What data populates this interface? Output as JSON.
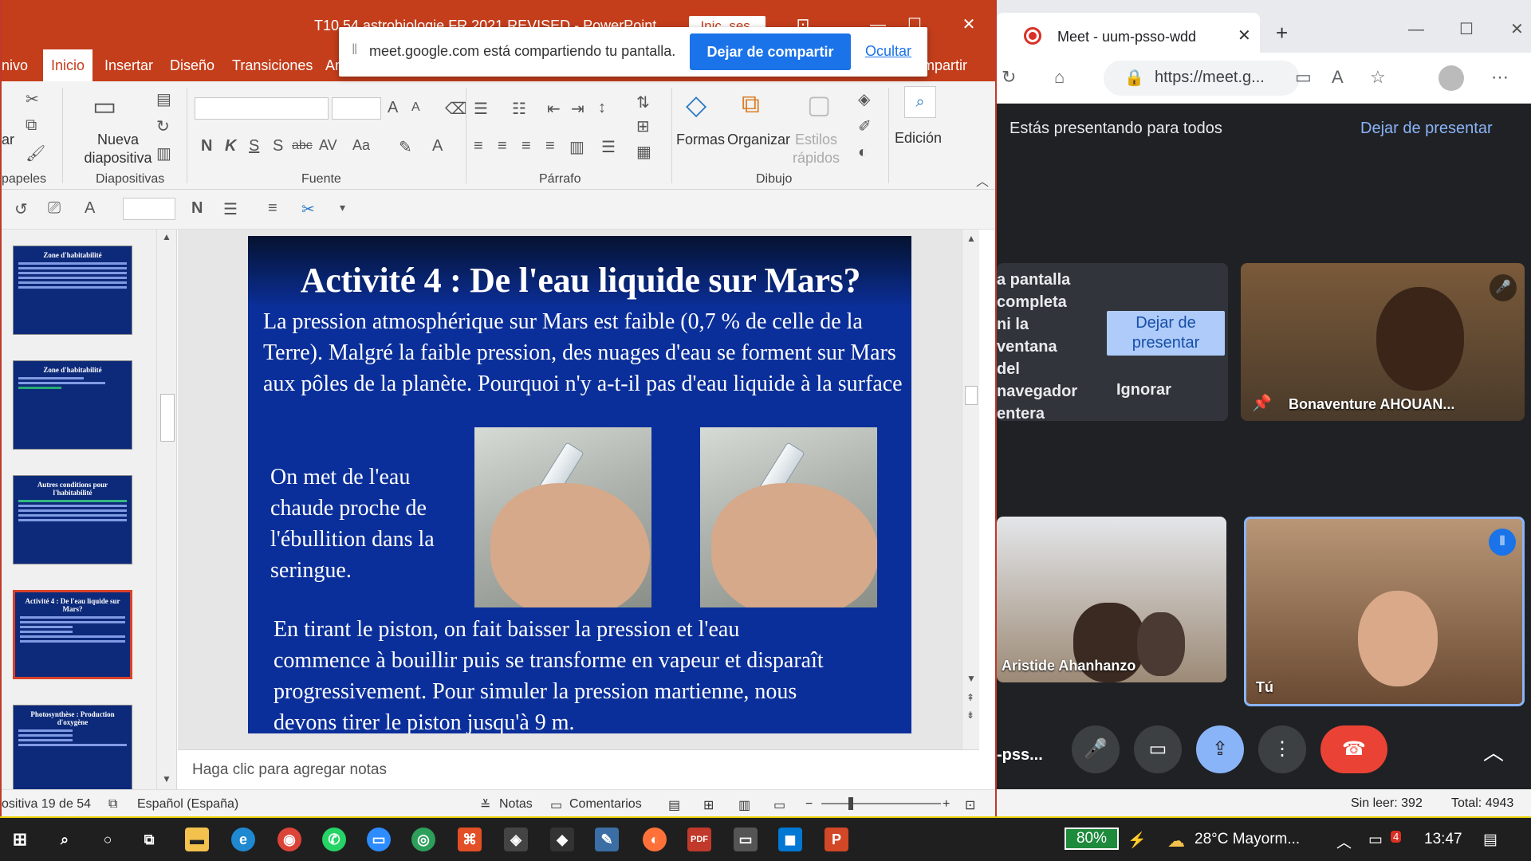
{
  "ppt": {
    "title": "T10 54 astrobiologie FR 2021 REVISED  -  PowerPoint",
    "signin": "Inic. ses.",
    "tabs": [
      "nivo",
      "Inicio",
      "Insertar",
      "Diseño",
      "Transiciones",
      "An",
      "mpartir"
    ],
    "ribbon": {
      "clipboard_cut_label": "ar",
      "clipboard_group": "papeles",
      "new_slide": "Nueva\ndiapositiva",
      "slides_group": "Diapositivas",
      "font_group": "Fuente",
      "para_group": "Párrafo",
      "shapes": "Formas",
      "arrange": "Organizar",
      "quick_styles": "Estilos\nrápidos",
      "draw_group": "Dibujo",
      "editing": "Edición",
      "font_btns": [
        "N",
        "K",
        "S",
        "S",
        "abc",
        "AV",
        "Aa"
      ]
    },
    "thumbnails": [
      {
        "title": "Zone d'habitabilité"
      },
      {
        "title": "Zone d'habitabilité"
      },
      {
        "title": "Autres conditions pour l'habitabilité"
      },
      {
        "title": "Activité 4 : De l'eau liquide sur Mars?"
      },
      {
        "title": "Photosynthèse : Production d'oxygène"
      }
    ],
    "slide": {
      "title": "Activité 4 : De l'eau liquide sur Mars?",
      "intro": "La pression atmosphérique sur Mars est faible (0,7 % de celle de la Terre). Malgré la faible pression, des nuages d'eau se forment sur Mars aux pôles de la planète. Pourquoi n'y a-t-il pas d'eau liquide à la surface",
      "left": "On met de l'eau chaude proche de l'ébullition dans la seringue.",
      "bottom": "En tirant le piston, on fait baisser la pression et l'eau commence à bouillir puis se transforme en vapeur et disparaît progressivement. Pour simuler la pression martienne, nous devons tirer le piston jusqu'à 9 m."
    },
    "notes_placeholder": "Haga clic para agregar notas",
    "status": {
      "slide": "ositiva 19 de 54",
      "lang": "Español (España)",
      "notes": "Notas",
      "comments": "Comentarios"
    }
  },
  "share_bar": {
    "text": "meet.google.com está compartiendo tu pantalla.",
    "stop": "Dejar de compartir",
    "hide": "Ocultar"
  },
  "browser": {
    "tab_title": "Meet - uum-psso-wdd",
    "url": "https://meet.g...",
    "banner": "Estás presentando para todos",
    "banner_stop": "Dejar de presentar",
    "present_tile": {
      "lines": [
        "a pantalla",
        "completa",
        "ni la",
        "ventana",
        "del",
        "navegador",
        "entera"
      ],
      "dejar": "Dejar de presentar",
      "ignorar": "Ignorar"
    },
    "participants": [
      {
        "name": "Bonaventure AHOUAN..."
      },
      {
        "name": "Aristide Ahanhanzo"
      },
      {
        "name": "Tú"
      }
    ],
    "meeting_code": "-pss...",
    "status_unread": "Sin leer: 392",
    "status_total": "Total: 4943"
  },
  "taskbar": {
    "battery": "80%",
    "weather": "28°C  Mayorm...",
    "time": "13:47",
    "notif_count": "4"
  }
}
